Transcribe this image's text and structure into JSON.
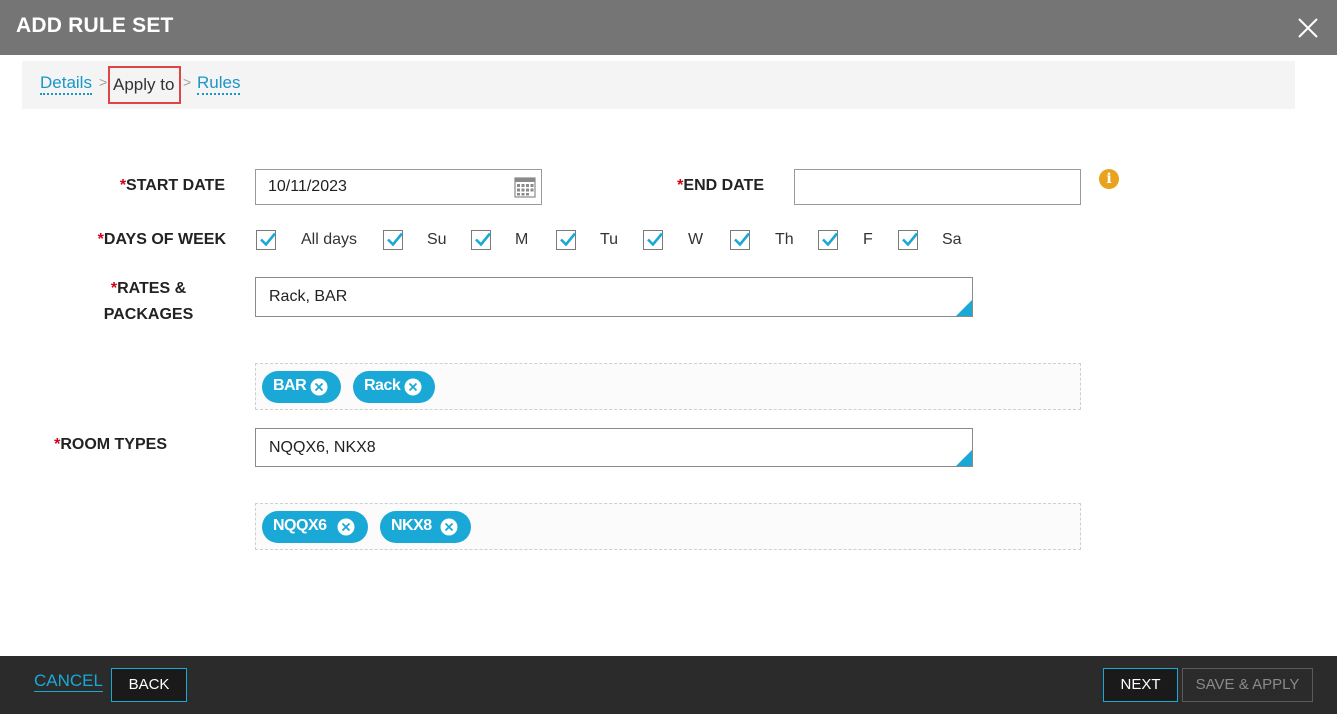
{
  "window": {
    "title": "ADD RULE SET"
  },
  "breadcrumb": {
    "details": "Details",
    "separator": ">",
    "apply_to": "Apply to",
    "rules": "Rules"
  },
  "form": {
    "required_mark": "*",
    "start_date": {
      "label": "START DATE",
      "value": "10/11/2023"
    },
    "end_date": {
      "label": "END DATE",
      "value": ""
    },
    "days_of_week": {
      "label": "DAYS OF WEEK",
      "options": [
        {
          "label": "All days",
          "checked": true
        },
        {
          "label": "Su",
          "checked": true
        },
        {
          "label": "M",
          "checked": true
        },
        {
          "label": "Tu",
          "checked": true
        },
        {
          "label": "W",
          "checked": true
        },
        {
          "label": "Th",
          "checked": true
        },
        {
          "label": "F",
          "checked": true
        },
        {
          "label": "Sa",
          "checked": true
        }
      ]
    },
    "rates_packages": {
      "label_line1": "RATES &",
      "label_line2": "PACKAGES",
      "value": "Rack, BAR",
      "tags": [
        "BAR",
        "Rack"
      ]
    },
    "room_types": {
      "label": "ROOM TYPES",
      "value": "NQQX6, NKX8",
      "tags": [
        "NQQX6",
        "NKX8"
      ]
    }
  },
  "footer": {
    "cancel": "CANCEL",
    "back": "BACK",
    "next": "NEXT",
    "save_apply": "SAVE & APPLY"
  },
  "colors": {
    "titlebar": "#757575",
    "accent": "#1aa8d6",
    "required": "#d0021b",
    "info": "#e8a21e",
    "footer": "#2b2b2b"
  },
  "icons": {
    "close": "close-icon",
    "calendar": "calendar-icon",
    "info": "info-icon",
    "check": "check-icon",
    "tag_remove": "remove-tag-icon"
  }
}
